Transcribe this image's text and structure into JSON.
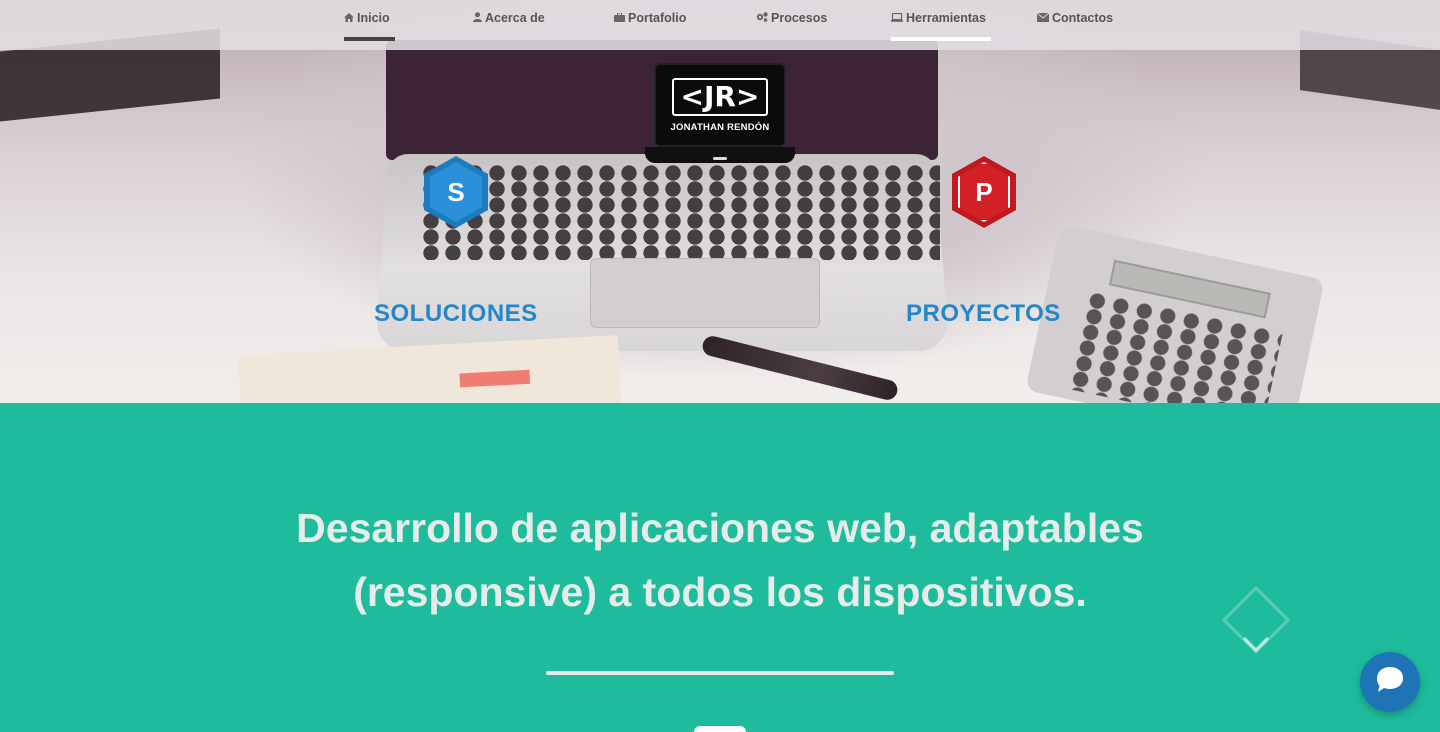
{
  "nav": {
    "items": [
      {
        "label": "Inicio",
        "icon": "home-icon"
      },
      {
        "label": "Acerca de",
        "icon": "user-icon"
      },
      {
        "label": "Portafolio",
        "icon": "briefcase-icon"
      },
      {
        "label": "Procesos",
        "icon": "gears-icon"
      },
      {
        "label": "Herramientas",
        "icon": "laptop-icon"
      },
      {
        "label": "Contactos",
        "icon": "envelope-icon"
      }
    ],
    "active": "Inicio"
  },
  "logo": {
    "mark": "<JR>",
    "name": "JONATHAN RENDÓN"
  },
  "hero": {
    "soluciones_badge": "S",
    "soluciones_label": "SOLUCIONES",
    "proyectos_badge": "P",
    "proyectos_label": "PROYECTOS"
  },
  "tagline": {
    "part1": "Desarrollo de aplicaciones web, ",
    "bold1": "adaptables",
    "bold2": "(responsive)",
    "part2": " a todos los dispositivos."
  },
  "colors": {
    "section_bg": "#1ebc9c",
    "link_blue": "#2487c8",
    "badge_blue": "#2b90d9",
    "badge_red": "#d32027",
    "chat_blue": "#1f73b7"
  },
  "widgets": {
    "scroll_icon": "chevron-diamond-icon",
    "chat_icon": "chat-icon"
  }
}
